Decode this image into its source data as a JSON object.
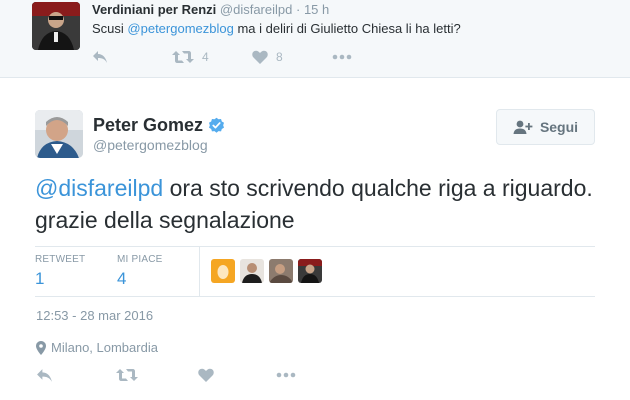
{
  "reply_tweet": {
    "name": "Verdiniani per Renzi",
    "handle": "@disfareilpd",
    "dot": "·",
    "time": "15 h",
    "text_prefix": "Scusi ",
    "mention": "@petergomezblog",
    "text_suffix": " ma i deliri di Giulietto Chiesa li ha letti?",
    "retweet_count": "4",
    "like_count": "8",
    "icons": [
      "reply-icon",
      "retweet-icon",
      "heart-icon",
      "more-icon"
    ]
  },
  "main_tweet": {
    "name": "Peter Gomez",
    "handle": "@petergomezblog",
    "follow_label": "Segui",
    "text_mention": "@disfareilpd",
    "text_body": " ora sto scrivendo qualche riga a riguardo. grazie della segnalazione",
    "stats": {
      "retweet_label": "RETWEET",
      "retweet_value": "1",
      "likes_label": "MI PIACE",
      "likes_value": "4"
    },
    "timestamp": "12:53 - 28 mar 2016",
    "location": "Milano, Lombardia",
    "icons": [
      "reply-icon",
      "retweet-icon",
      "heart-icon",
      "more-icon",
      "verified-badge-icon",
      "follow-user-icon",
      "location-pin-icon"
    ]
  },
  "colors": {
    "accent": "#3b94d9",
    "muted": "#8899a6",
    "action_icon": "#aab8c2",
    "verified": "#55acee",
    "header_bg": "#f5f8fa"
  }
}
